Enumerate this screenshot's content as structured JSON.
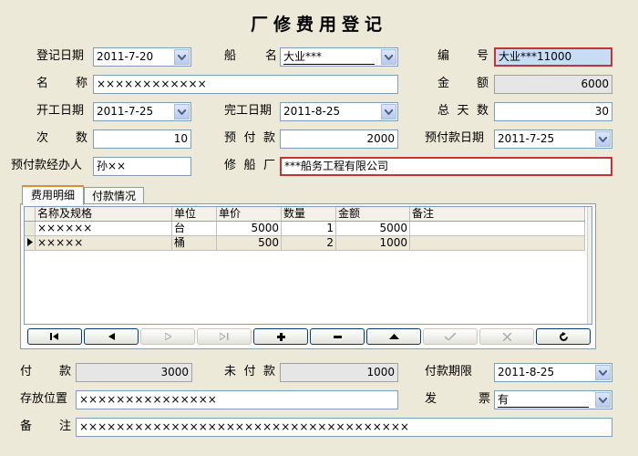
{
  "title": "厂修费用登记",
  "form": {
    "reg_date_label": "登记日期",
    "reg_date": "2011-7-20",
    "ship_label": "船 名",
    "ship_value": "大业***",
    "serial_label": "编 号",
    "serial_value": "大业***11000",
    "name_label": "名 称",
    "name_value": "××××××××××××",
    "amount_label": "金 额",
    "amount_value": "6000",
    "start_label": "开工日期",
    "start_value": "2011-7-25",
    "finish_label": "完工日期",
    "finish_value": "2011-8-25",
    "days_label": "总天数",
    "days_value": "30",
    "times_label": "次 数",
    "times_value": "10",
    "prepay_label": "预付款",
    "prepay_value": "2000",
    "prepay_date_label": "预付款日期",
    "prepay_date_value": "2011-7-25",
    "handler_label": "预付款经办人",
    "handler_value": "孙××",
    "shipyard_label": "修船厂",
    "shipyard_value": "***船务工程有限公司"
  },
  "tabs": [
    "费用明细",
    "付款情况"
  ],
  "grid": {
    "columns": [
      "名称及规格",
      "单位",
      "单价",
      "数量",
      "金额",
      "备注"
    ],
    "rows": [
      {
        "name": "××××××",
        "unit": "台",
        "price": "5000",
        "qty": "1",
        "amount": "5000",
        "note": ""
      },
      {
        "name": "×××××",
        "unit": "桶",
        "price": "500",
        "qty": "2",
        "amount": "1000",
        "note": ""
      }
    ]
  },
  "footer": {
    "paid_label": "付 款",
    "paid_value": "3000",
    "unpaid_label": "未付款",
    "unpaid_value": "1000",
    "deadline_label": "付款期限",
    "deadline_value": "2011-8-25",
    "location_label": "存放位置",
    "location_value": "×××××××××××××××",
    "invoice_label": "发 票",
    "invoice_value": "有",
    "remark_label": "备 注",
    "remark_value": "××××××××××××××××××××××××××××××××××××"
  },
  "icons": {
    "nav": [
      "first-icon",
      "prior-icon",
      "next-icon",
      "last-icon",
      "insert-icon",
      "delete-icon",
      "edit-icon",
      "post-icon",
      "cancel-icon",
      "refresh-icon"
    ]
  }
}
